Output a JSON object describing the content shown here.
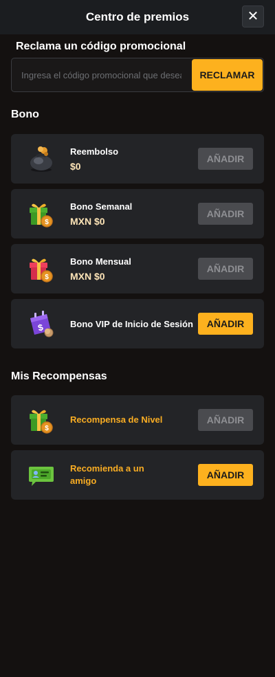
{
  "header": {
    "title": "Centro de premios",
    "close_label": "✕"
  },
  "promo": {
    "title": "Reclama un código promocional",
    "placeholder": "Ingresa el código promocional que deseas usar",
    "claim_label": "RECLAMAR"
  },
  "bono": {
    "title": "Bono",
    "items": [
      {
        "name": "Reembolso",
        "value": "$0",
        "button": "AÑADIR",
        "enabled": false,
        "icon": "money-bag-icon"
      },
      {
        "name": "Bono Semanal",
        "value": "MXN $0",
        "button": "AÑADIR",
        "enabled": false,
        "icon": "green-gift-icon"
      },
      {
        "name": "Bono Mensual",
        "value": "MXN $0",
        "button": "AÑADIR",
        "enabled": false,
        "icon": "red-gift-icon"
      },
      {
        "name": "Bono VIP de Inicio de Sesión",
        "button": "AÑADIR",
        "enabled": true,
        "icon": "vip-calendar-icon"
      }
    ]
  },
  "rewards": {
    "title": "Mis Recompensas",
    "items": [
      {
        "name": "Recompensa de Nivel",
        "button": "AÑADIR",
        "enabled": false,
        "icon": "green-gift-icon"
      },
      {
        "name_line1": "Recomienda a un",
        "name_line2": "amigo",
        "button": "AÑADIR",
        "enabled": true,
        "icon": "referral-card-icon"
      }
    ]
  },
  "colors": {
    "accent": "#fdb11e",
    "background": "#141110",
    "card": "#232427",
    "disabled_button": "#4a4b4f"
  }
}
